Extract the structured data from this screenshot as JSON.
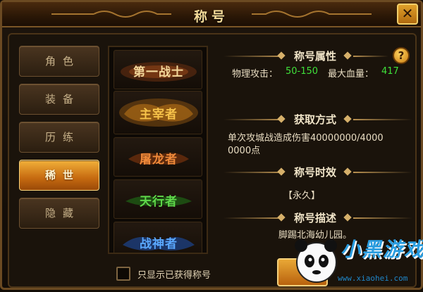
{
  "window": {
    "title": "称号"
  },
  "tabs": [
    {
      "label": "角色",
      "active": false
    },
    {
      "label": "装备",
      "active": false
    },
    {
      "label": "历练",
      "active": false
    },
    {
      "label": "稀世",
      "active": true
    },
    {
      "label": "隐藏",
      "active": false
    }
  ],
  "titles": [
    {
      "text": "第一战士",
      "color": "#f3d79a"
    },
    {
      "text": "主宰者",
      "color": "#f7c34a"
    },
    {
      "text": "屠龙者",
      "color": "#f08a3a"
    },
    {
      "text": "天行者",
      "color": "#5fd84a"
    },
    {
      "text": "战神者",
      "color": "#5aa8ff"
    }
  ],
  "info": {
    "attr_title": "称号属性",
    "attack_label": "物理攻击：",
    "attack_value": "50-150",
    "hp_label": "最大血量：",
    "hp_value": "417",
    "obtain_title": "获取方式",
    "obtain_line1": "单次攻城战造成伤害40000000/4000",
    "obtain_line2": "0000点",
    "duration_title": "称号时效",
    "duration_value": "【永久】",
    "desc_title": "称号描述",
    "desc_value": "脚踢北海幼儿园。"
  },
  "filter": {
    "label": "只显示已获得称号",
    "checked": false
  },
  "watermark": {
    "name": "小黑游戏",
    "url": "www.xiaohei.com"
  },
  "colors": {
    "accent": "#f2b13a",
    "green": "#3fe03a",
    "gold": "#f5dc9a"
  }
}
